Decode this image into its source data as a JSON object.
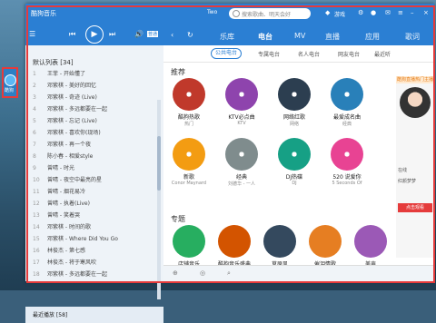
{
  "desktop": {
    "icon_label": "酷狗"
  },
  "app": {
    "title": "酷狗音乐",
    "user": "Two",
    "search_placeholder": "搜索歌曲、明天会好"
  },
  "top_icons": {
    "game": "游戏",
    "skin": "皮肤"
  },
  "tabs": [
    {
      "label": "乐库"
    },
    {
      "label": "电台"
    },
    {
      "label": "MV"
    },
    {
      "label": "直播"
    },
    {
      "label": "应用"
    },
    {
      "label": "歌词"
    }
  ],
  "player": {
    "mode": "普通"
  },
  "playlist": {
    "header": "默认列表 [34]",
    "songs": [
      {
        "num": "1",
        "title": "王菲 - 开始懂了"
      },
      {
        "num": "2",
        "title": "邓紫棋 - 美好的回忆"
      },
      {
        "num": "3",
        "title": "邓紫棋 - 奇迹 (Live)"
      },
      {
        "num": "4",
        "title": "邓紫棋 - 多远都要在一起"
      },
      {
        "num": "5",
        "title": "邓紫棋 - 忘记 (Live)"
      },
      {
        "num": "6",
        "title": "邓紫棋 - 喜欢你(现场)"
      },
      {
        "num": "7",
        "title": "邓紫棋 - 再一个夜"
      },
      {
        "num": "8",
        "title": "陈小春 - 相爱style"
      },
      {
        "num": "9",
        "title": "曾晴 - 时光"
      },
      {
        "num": "10",
        "title": "曾晴 - 夜空中最亮的星"
      },
      {
        "num": "11",
        "title": "曾晴 - 烟花易冷"
      },
      {
        "num": "12",
        "title": "曾晴 - 执着(Live)"
      },
      {
        "num": "13",
        "title": "曾晴 - 笑着哭"
      },
      {
        "num": "14",
        "title": "邓紫棋 - 时间的歌"
      },
      {
        "num": "15",
        "title": "邓紫棋 - Where Did You Go"
      },
      {
        "num": "16",
        "title": "林俊杰 - 第七感"
      },
      {
        "num": "17",
        "title": "林俊杰 - 将于寒风吹"
      },
      {
        "num": "18",
        "title": "邓紫棋 - 多远都要在一起"
      }
    ],
    "bottom_label": "最近播放 [58]"
  },
  "subnav": [
    {
      "label": "公共电台"
    },
    {
      "label": "专属电台"
    },
    {
      "label": "名人电台"
    },
    {
      "label": "网友电台"
    },
    {
      "label": "最近听"
    }
  ],
  "section_recommend": "推荐",
  "recommend": [
    {
      "title": "酷狗热歌",
      "sub": "热门"
    },
    {
      "title": "KTV必点曲",
      "sub": "KTV"
    },
    {
      "title": "网络红歌",
      "sub": "网络"
    },
    {
      "title": "最爱成名曲",
      "sub": "经典"
    },
    {
      "title": "新歌",
      "sub": "Conor Maynard"
    },
    {
      "title": "经典",
      "sub": "刘德华 - 一人"
    },
    {
      "title": "DJ热碟",
      "sub": "DJ"
    },
    {
      "title": "520 说爱你",
      "sub": "5 Seconds Of"
    }
  ],
  "section_special": "专题",
  "special": [
    {
      "title": "店铺音乐"
    },
    {
      "title": "酷狗音乐盛典"
    },
    {
      "title": "草原风"
    },
    {
      "title": "催泪情歌"
    },
    {
      "title": "美声"
    }
  ],
  "promo": {
    "ad": "酷狗直播热门主播",
    "name": "红颜梦梦",
    "status": "在线",
    "action": "点击观看"
  }
}
